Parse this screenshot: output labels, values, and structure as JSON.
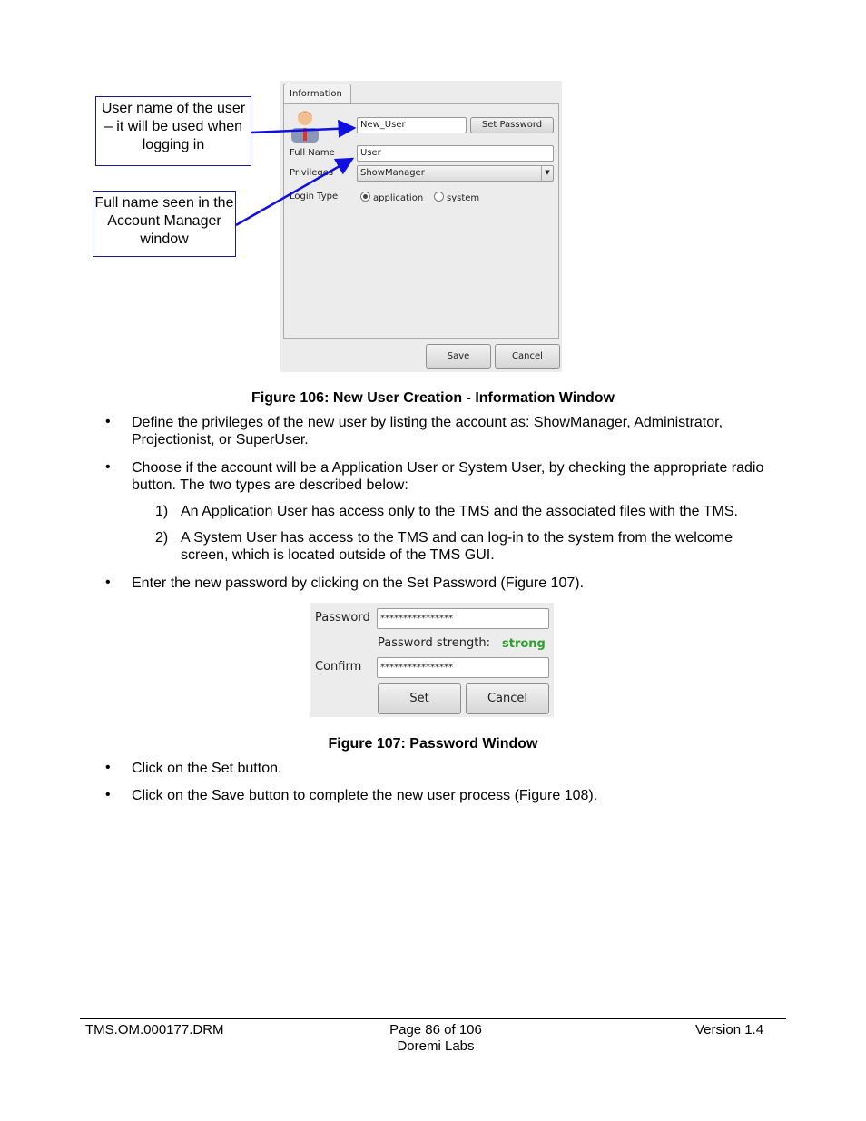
{
  "callouts": {
    "username": "User name of the user – it will be used when logging in",
    "fullname": "Full name seen in the Account Manager window"
  },
  "info_window": {
    "tab": "Information",
    "username_value": "New_User",
    "set_password": "Set Password",
    "full_name_label": "Full Name",
    "full_name_value": "User",
    "privileges_label": "Privileges",
    "privileges_value": "ShowManager",
    "login_type_label": "Login Type",
    "login_options": [
      "application",
      "system"
    ],
    "selected_login": "application",
    "save": "Save",
    "cancel": "Cancel"
  },
  "fig106_caption": "Figure 106: New User Creation - Information Window",
  "bullets1": [
    "Define the privileges of the new user by listing the account as: ShowManager, Administrator, Projectionist, or SuperUser.",
    "Choose if the account will be a Application User or System User, by checking the appropriate radio button. The two types are described below:"
  ],
  "numbered": [
    {
      "n": "1)",
      "text": "An Application User has access only to the TMS and the associated files with the TMS."
    },
    {
      "n": "2)",
      "text": "A System User has access to the TMS and can log-in to the system from the welcome screen, which is located outside of the TMS GUI."
    }
  ],
  "bullet3": "Enter the new password by clicking on the Set Password (Figure 107).",
  "password_window": {
    "password_label": "Password",
    "password_value": "****************",
    "strength_label": "Password strength:",
    "strength_value": "strong",
    "strength_color": "#2ea02e",
    "confirm_label": "Confirm",
    "confirm_value": "****************",
    "set": "Set",
    "cancel": "Cancel"
  },
  "fig107_caption": "Figure 107: Password Window",
  "bullets2": [
    "Click on the Set button.",
    "Click on the Save button to complete the new user process (Figure 108)."
  ],
  "footer": {
    "left": "TMS.OM.000177.DRM",
    "center": "Page 86 of 106",
    "center2": "Doremi Labs",
    "right": "Version 1.4"
  },
  "bullet_char": "•"
}
